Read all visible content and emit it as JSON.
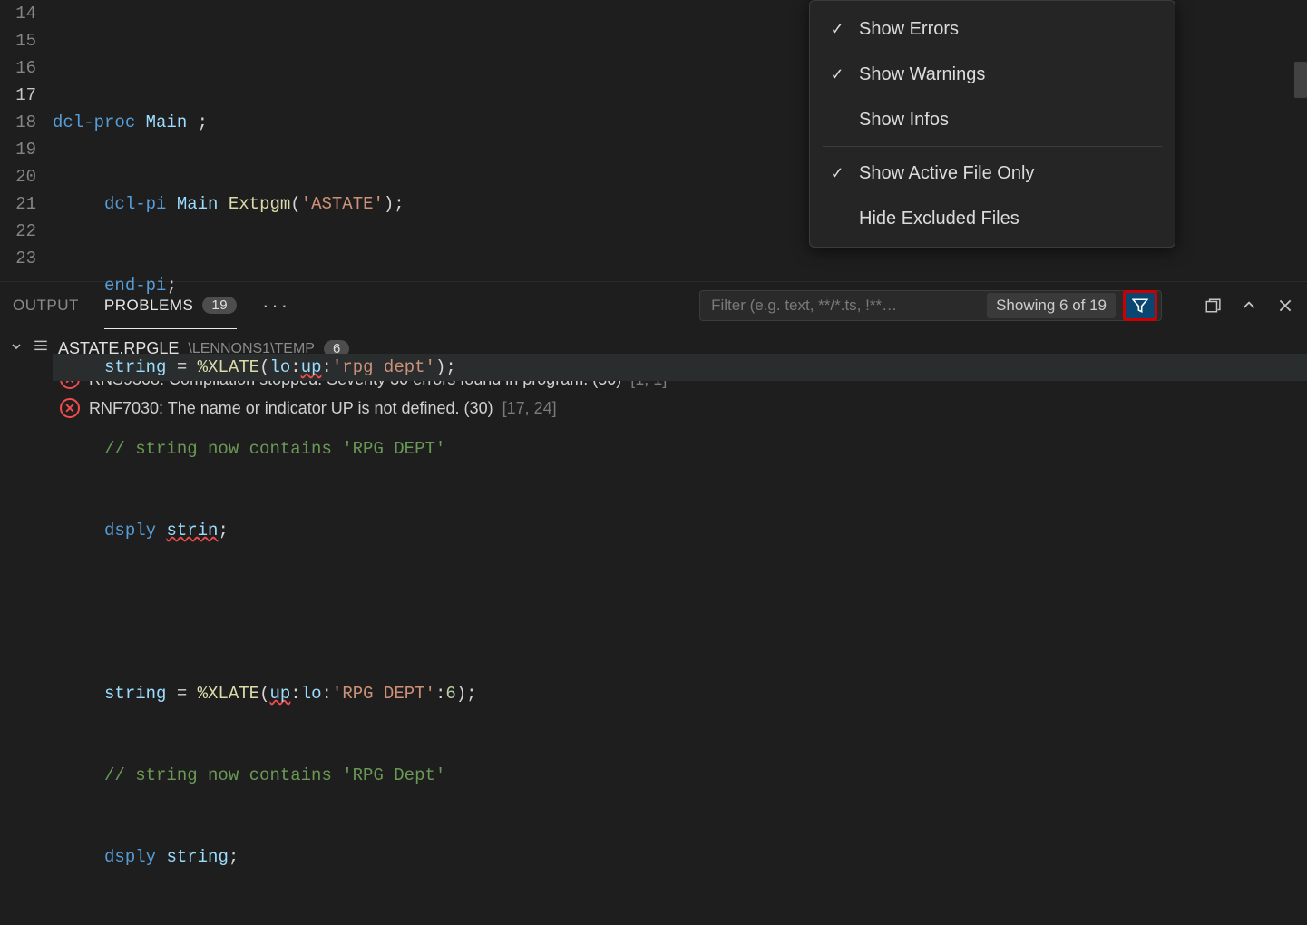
{
  "editor": {
    "lines": [
      {
        "num": "14"
      },
      {
        "num": "15"
      },
      {
        "num": "16"
      },
      {
        "num": "17",
        "current": true
      },
      {
        "num": "18"
      },
      {
        "num": "19"
      },
      {
        "num": "20"
      },
      {
        "num": "21"
      },
      {
        "num": "22"
      },
      {
        "num": "23"
      }
    ],
    "l14_kw": "dcl-proc",
    "l14_id": "Main",
    "l14_sc": " ;",
    "l15_kw": "dcl-pi",
    "l15_id": "Main",
    "l15_fn": "Extpgm",
    "l15_op": "(",
    "l15_str": "'ASTATE'",
    "l15_cl": ");",
    "l16_kw": "end-pi",
    "l16_sc": ";",
    "l17_id": "string",
    "l17_eq": " = ",
    "l17_fn": "%XLATE",
    "l17_op": "(",
    "l17_a1": "lo",
    "l17_c1": ":",
    "l17_a2": "up",
    "l17_c2": ":",
    "l17_str": "'rpg dept'",
    "l17_cl": ");",
    "l18_cmt": "// string now contains 'RPG DEPT'",
    "l19_kw": "dsply",
    "l19_id": "strin",
    "l19_sc": ";",
    "l21_id": "string",
    "l21_eq": " = ",
    "l21_fn": "%XLATE",
    "l21_op": "(",
    "l21_a1": "up",
    "l21_c1": ":",
    "l21_a2": "lo",
    "l21_c2": ":",
    "l21_str": "'RPG DEPT'",
    "l21_c3": ":",
    "l21_num": "6",
    "l21_cl": ");",
    "l22_cmt": "// string now contains 'RPG Dept'",
    "l23_kw": "dsply",
    "l23_id": "string",
    "l23_sc": ";"
  },
  "ctx": {
    "showErrors": "Show Errors",
    "showWarnings": "Show Warnings",
    "showInfos": "Show Infos",
    "activeOnly": "Show Active File Only",
    "hideExcluded": "Hide Excluded Files",
    "check": "✓"
  },
  "panel": {
    "output": "OUTPUT",
    "problems": "PROBLEMS",
    "problemsCount": "19",
    "more": "···",
    "filterPlaceholder": "Filter (e.g. text, **/*.ts, !**…",
    "filterCount": "Showing 6 of 19"
  },
  "problems": {
    "file": "ASTATE.RPGLE",
    "path": "\\LENNONS1\\TEMP",
    "fileCount": "6",
    "items": [
      {
        "msg": "RNS9308: Compilation stopped. Severity 30 errors found in program. (50)",
        "loc": "[1, 1]"
      },
      {
        "msg": "RNF7030: The name or indicator UP is not defined. (30)",
        "loc": "[17, 24]"
      }
    ]
  }
}
